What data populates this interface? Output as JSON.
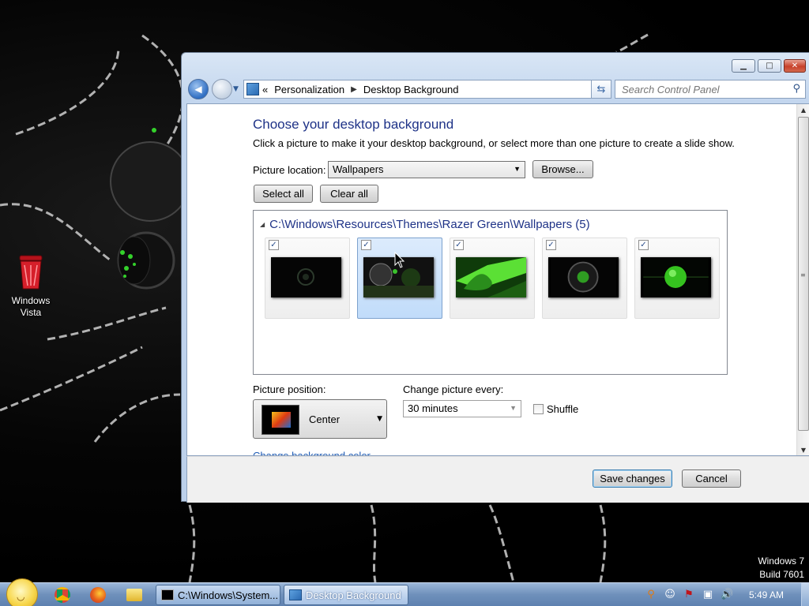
{
  "desktop": {
    "icons": [
      {
        "label_line1": "Windows",
        "label_line2": "Vista",
        "icon": "recycle-bin-icon"
      }
    ],
    "watermark": {
      "line1": "Windows 7",
      "line2": "Build 7601"
    }
  },
  "window": {
    "breadcrumb": {
      "items": [
        "Personalization",
        "Desktop Background"
      ],
      "prefix": "«"
    },
    "search_placeholder": "Search Control Panel",
    "title": "Choose your desktop background",
    "description": "Click a picture to make it your desktop background, or select more than one picture to create a slide show.",
    "picture_location": {
      "label": "Picture location:",
      "value": "Wallpapers",
      "browse": "Browse..."
    },
    "select_all": "Select all",
    "clear_all": "Clear all",
    "gallery": {
      "header": "C:\\Windows\\Resources\\Themes\\Razer Green\\Wallpapers (5)",
      "items": [
        {
          "checked": true,
          "selected": false
        },
        {
          "checked": true,
          "selected": true
        },
        {
          "checked": true,
          "selected": false
        },
        {
          "checked": true,
          "selected": false
        },
        {
          "checked": true,
          "selected": false
        }
      ]
    },
    "picture_position": {
      "label": "Picture position:",
      "value": "Center"
    },
    "change_every": {
      "label": "Change picture every:",
      "value": "30 minutes"
    },
    "shuffle": {
      "label": "Shuffle",
      "checked": false
    },
    "change_color_link": "Change background color",
    "save": "Save changes",
    "cancel": "Cancel"
  },
  "taskbar": {
    "tasks": [
      {
        "label": "C:\\Windows\\System...",
        "active": false
      },
      {
        "label": "Desktop Background",
        "active": true
      }
    ],
    "clock": "5:49 AM"
  },
  "colors": {
    "accent": "#1e3287",
    "link": "#1e5bb5",
    "selection": "#c1dcfa"
  }
}
